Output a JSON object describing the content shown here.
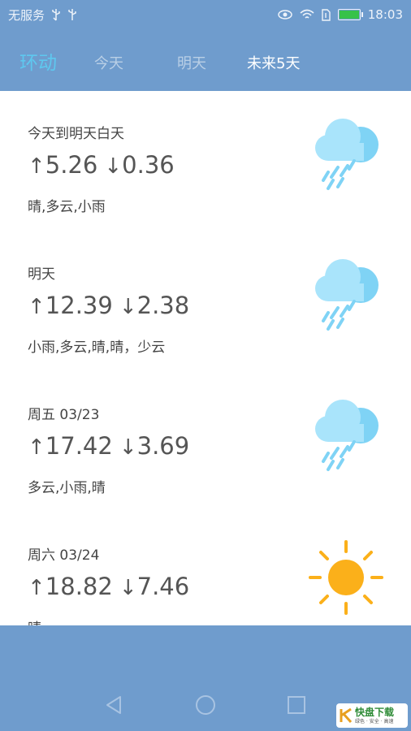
{
  "status_bar": {
    "carrier": "无服务",
    "time": "18:03",
    "icons": [
      "usb-icon",
      "usb-icon",
      "eye-icon",
      "wifi-icon",
      "sim-icon",
      "battery-icon"
    ]
  },
  "header": {
    "brand": "环动",
    "tabs": [
      {
        "label": "今天",
        "active": false
      },
      {
        "label": "明天",
        "active": false
      },
      {
        "label": "未来5天",
        "active": true
      }
    ]
  },
  "forecast": [
    {
      "title": "今天到明天白天",
      "high": "5.26",
      "low": "0.36",
      "desc": "晴,多云,小雨",
      "icon": "rain-icon"
    },
    {
      "title": "明天",
      "high": "12.39",
      "low": "2.38",
      "desc": "小雨,多云,晴,晴，少云",
      "icon": "rain-icon"
    },
    {
      "title": "周五 03/23",
      "high": "17.42",
      "low": "3.69",
      "desc": "多云,小雨,晴",
      "icon": "rain-icon"
    },
    {
      "title": "周六 03/24",
      "high": "18.82",
      "low": "7.46",
      "desc": "晴",
      "icon": "sun-icon"
    }
  ],
  "arrows": {
    "up": "↑",
    "down": "↓"
  },
  "watermark": {
    "text": "快盘下载",
    "sub": "绿色 · 安全 · 高速"
  },
  "colors": {
    "bar": "#6f9ccd",
    "brand": "#5ec8ef",
    "cloud": "#7fd3f5",
    "sun": "#fbb01a"
  }
}
